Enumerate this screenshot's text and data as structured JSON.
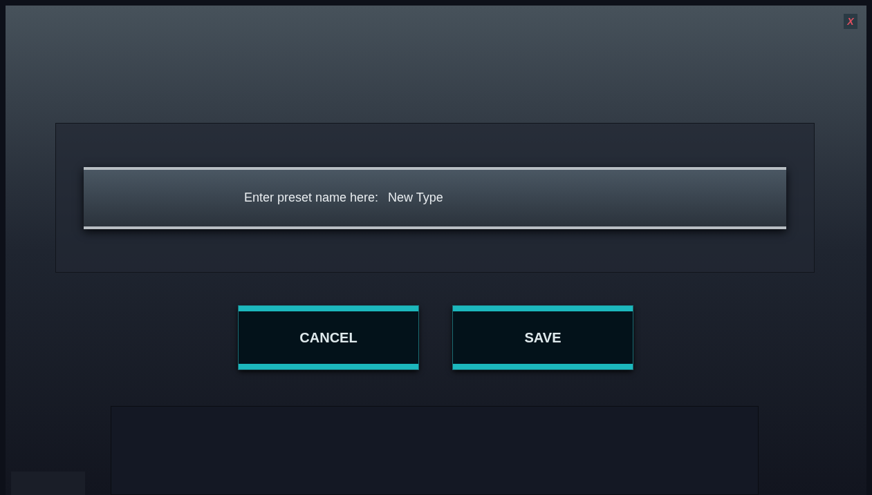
{
  "dialog": {
    "close": "X"
  },
  "preset": {
    "label": "Enter preset name here:",
    "value": "New Type"
  },
  "buttons": [
    {
      "label": "CANCEL"
    },
    {
      "label": "SAVE"
    }
  ]
}
